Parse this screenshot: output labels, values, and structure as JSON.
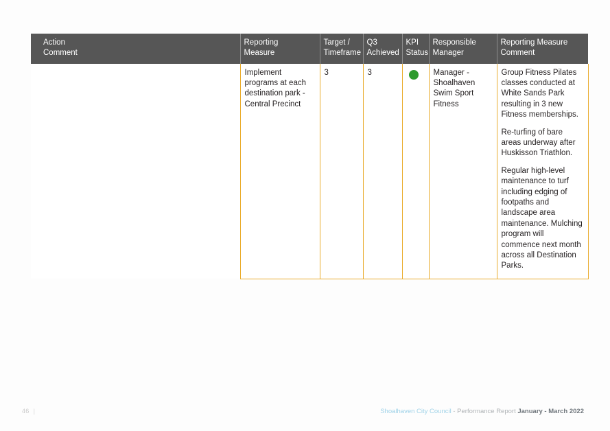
{
  "page": {
    "number": "46",
    "divider": "|"
  },
  "table": {
    "headers": [
      {
        "name": "action-comment",
        "label": "Action\nComment"
      },
      {
        "name": "reporting-measure",
        "label": "Reporting\nMeasure"
      },
      {
        "name": "target-timeframe",
        "label": "Target /\nTimeframe"
      },
      {
        "name": "q3-achieved",
        "label": "Q3\nAchieved"
      },
      {
        "name": "kpi-status",
        "label": "KPI\nStatus"
      },
      {
        "name": "responsible-manager",
        "label": "Responsible\nManager"
      },
      {
        "name": "reporting-measure-comment",
        "label": "Reporting Measure\nComment"
      }
    ],
    "rows": [
      {
        "action_comment": "",
        "reporting_measure": "Implement programs at each destination park - Central Precinct",
        "target_timeframe": "3",
        "q3_achieved": "3",
        "kpi_status": {
          "icon": "status-dot-green",
          "color": "#2e9b2e",
          "label": "Green"
        },
        "responsible_manager": "Manager - Shoalhaven Swim Sport Fitness",
        "reporting_measure_comment": [
          "Group Fitness Pilates classes conducted at White Sands Park resulting in 3 new Fitness memberships.",
          "Re-turfing of bare areas underway after Huskisson Triathlon.",
          "Regular high-level maintenance to turf including edging of footpaths and landscape area maintenance. Mulching program will commence next month across all Destination Parks."
        ]
      }
    ]
  },
  "footer": {
    "organisation": "Shoalhaven City Council",
    "separator": " - ",
    "document": "Performance Report ",
    "period": "January - March 2022"
  },
  "colors": {
    "header_background": "#565656",
    "table_border": "#eaac2c",
    "status_green": "#2e9b2e",
    "brand_blue": "#9ed2e8"
  }
}
